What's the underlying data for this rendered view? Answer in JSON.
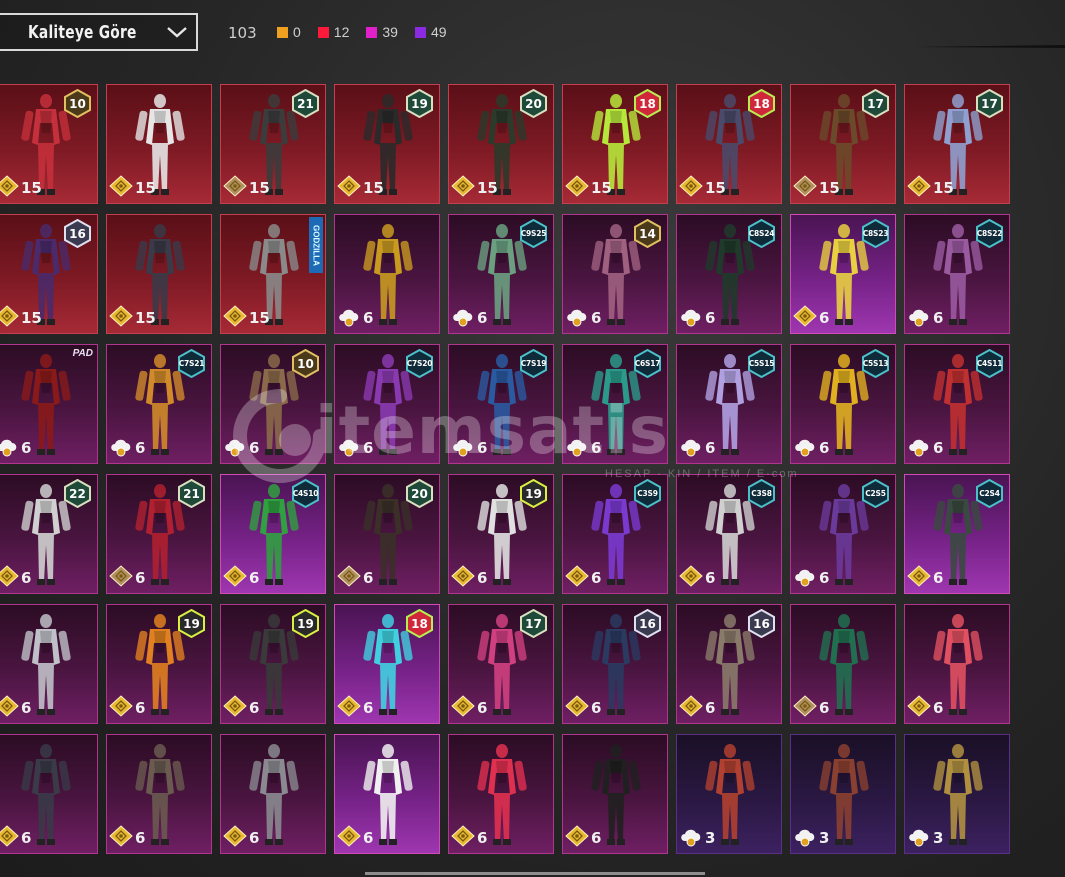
{
  "filter": {
    "label": "Kaliteye Göre"
  },
  "summary": {
    "total": "103",
    "legend": [
      {
        "color": "#f0a020",
        "count": "0"
      },
      {
        "color": "#ff1a3c",
        "count": "12"
      },
      {
        "color": "#e020c8",
        "count": "39"
      },
      {
        "color": "#8a2be2",
        "count": "49"
      }
    ]
  },
  "watermark": {
    "text": "itemsatis",
    "sub": "HESAP · KIN / ITEM / E·com"
  },
  "rows": [
    [
      {
        "t": "red",
        "b": "10",
        "a": "15",
        "c": "g",
        "f": "#c4303b"
      },
      {
        "t": "red",
        "b": "",
        "a": "15",
        "c": "g",
        "f": "#e6e6e6"
      },
      {
        "t": "red",
        "b": "21",
        "a": "15",
        "c": "gd",
        "f": "#3c3c3c"
      },
      {
        "t": "red",
        "b": "19",
        "a": "15",
        "c": "g",
        "f": "#2a2a2a"
      },
      {
        "t": "red",
        "b": "20",
        "a": "15",
        "c": "g",
        "f": "#2b3a2a"
      },
      {
        "t": "red",
        "b": "18",
        "a": "15",
        "c": "g",
        "f": "#b6e83b"
      },
      {
        "t": "red",
        "b": "18",
        "a": "15",
        "c": "g",
        "f": "#4a4a6a"
      },
      {
        "t": "red",
        "b": "17",
        "a": "15",
        "c": "gd",
        "f": "#6b4a2a"
      },
      {
        "t": "red",
        "b": "17",
        "a": "15",
        "c": "g",
        "f": "#8fa0d0"
      }
    ],
    [
      {
        "t": "red",
        "b": "16",
        "a": "15",
        "c": "g",
        "f": "#4a2a6a"
      },
      {
        "t": "red",
        "b": "",
        "a": "15",
        "c": "g",
        "f": "#3a3a48"
      },
      {
        "t": "red",
        "b": "GODZILLA",
        "a": "15",
        "c": "g",
        "f": "#8a8a8a"
      },
      {
        "t": "purple",
        "b": "",
        "a": "6",
        "c": "w",
        "f": "#c89a20"
      },
      {
        "t": "purple",
        "b": "C9S25",
        "a": "6",
        "c": "w",
        "f": "#6aa080"
      },
      {
        "t": "purple",
        "b": "14",
        "a": "6",
        "c": "w",
        "f": "#a06080"
      },
      {
        "t": "purple",
        "b": "C8S24",
        "a": "6",
        "c": "w",
        "f": "#1f3a2a"
      },
      {
        "t": "mag",
        "b": "C8S23",
        "a": "6",
        "c": "g",
        "f": "#e8d040"
      },
      {
        "t": "purple",
        "b": "C8S22",
        "a": "6",
        "c": "w",
        "f": "#9a5aa0"
      }
    ],
    [
      {
        "t": "purple",
        "b": "PAD",
        "a": "6",
        "c": "w",
        "f": "#8a1a1a"
      },
      {
        "t": "purple",
        "b": "C7S21",
        "a": "6",
        "c": "w",
        "f": "#d08a2a"
      },
      {
        "t": "purple",
        "b": "10",
        "a": "6",
        "c": "w",
        "f": "#8a6a4a"
      },
      {
        "t": "purple",
        "b": "C7S20",
        "a": "6",
        "c": "w",
        "f": "#8a3ab0"
      },
      {
        "t": "purple",
        "b": "C7S19",
        "a": "6",
        "c": "w",
        "f": "#2a5aa0"
      },
      {
        "t": "purple",
        "b": "C6S17",
        "a": "6",
        "c": "w",
        "f": "#2a9a8a"
      },
      {
        "t": "purple",
        "b": "C5S15",
        "a": "6",
        "c": "w",
        "f": "#b0a0e0"
      },
      {
        "t": "purple",
        "b": "C5S13",
        "a": "6",
        "c": "w",
        "f": "#e0b020"
      },
      {
        "t": "purple",
        "b": "C4S11",
        "a": "6",
        "c": "w",
        "f": "#c03030"
      }
    ],
    [
      {
        "t": "purple",
        "b": "22",
        "a": "6",
        "c": "g",
        "f": "#d0d0d0"
      },
      {
        "t": "purple",
        "b": "21",
        "a": "6",
        "c": "gd",
        "f": "#b02030"
      },
      {
        "t": "mag",
        "b": "C4S10",
        "a": "6",
        "c": "g",
        "f": "#30a040"
      },
      {
        "t": "purple",
        "b": "20",
        "a": "6",
        "c": "gd",
        "f": "#3a3028"
      },
      {
        "t": "purple",
        "b": "19",
        "a": "6",
        "c": "g",
        "f": "#e0e0e0"
      },
      {
        "t": "purple",
        "b": "C3S9",
        "a": "6",
        "c": "g",
        "f": "#7a3ad0"
      },
      {
        "t": "purple",
        "b": "C3S8",
        "a": "6",
        "c": "g",
        "f": "#d0d0d0"
      },
      {
        "t": "purple",
        "b": "C2S5",
        "a": "6",
        "c": "w",
        "f": "#6a3a9a"
      },
      {
        "t": "mag",
        "b": "C2S4",
        "a": "6",
        "c": "g",
        "f": "#3a4a40"
      }
    ],
    [
      {
        "t": "purple",
        "b": "",
        "a": "6",
        "c": "g",
        "f": "#c0c0c8"
      },
      {
        "t": "purple",
        "b": "19",
        "a": "6",
        "c": "g",
        "f": "#e08020"
      },
      {
        "t": "purple",
        "b": "19",
        "a": "6",
        "c": "g",
        "f": "#3a3a3a"
      },
      {
        "t": "mag",
        "b": "18",
        "a": "6",
        "c": "g",
        "f": "#40d0e0"
      },
      {
        "t": "purple",
        "b": "17",
        "a": "6",
        "c": "g",
        "f": "#d04080"
      },
      {
        "t": "purple",
        "b": "16",
        "a": "6",
        "c": "g",
        "f": "#2a3a60"
      },
      {
        "t": "purple",
        "b": "16",
        "a": "6",
        "c": "g",
        "f": "#8a7a6a"
      },
      {
        "t": "purple",
        "b": "",
        "a": "6",
        "c": "gd",
        "f": "#207050"
      },
      {
        "t": "purple",
        "b": "",
        "a": "6",
        "c": "g",
        "f": "#e05060"
      }
    ],
    [
      {
        "t": "purple",
        "b": "",
        "a": "6",
        "c": "g",
        "f": "#3a3a48"
      },
      {
        "t": "purple",
        "b": "",
        "a": "6",
        "c": "g",
        "f": "#6a5a50"
      },
      {
        "t": "purple",
        "b": "",
        "a": "6",
        "c": "g",
        "f": "#8a8a90"
      },
      {
        "t": "mag",
        "b": "",
        "a": "6",
        "c": "g",
        "f": "#f0f0f0"
      },
      {
        "t": "purple",
        "b": "",
        "a": "6",
        "c": "g",
        "f": "#e03050"
      },
      {
        "t": "purple",
        "b": "",
        "a": "6",
        "c": "g",
        "f": "#202020"
      },
      {
        "t": "dim",
        "b": "",
        "a": "3",
        "c": "w",
        "f": "#b04030"
      },
      {
        "t": "dim",
        "b": "",
        "a": "3",
        "c": "w",
        "f": "#8a4030"
      },
      {
        "t": "dim",
        "b": "",
        "a": "3",
        "c": "w",
        "f": "#b09040"
      }
    ]
  ]
}
